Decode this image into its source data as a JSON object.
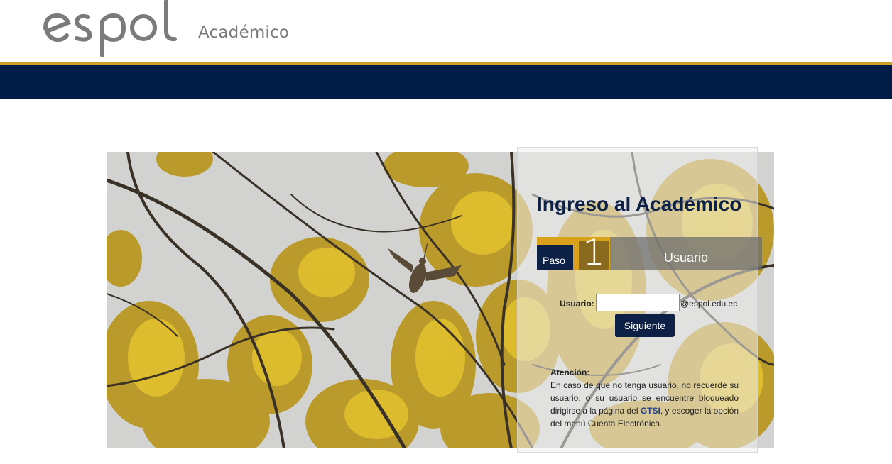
{
  "header": {
    "logo_text": "espol",
    "subtitle": "Académico"
  },
  "colors": {
    "navy": "#001c44",
    "gold": "#c9a227",
    "panel_title": "#0d2147"
  },
  "login": {
    "title": "Ingreso al Académico",
    "step_prefix": "Paso",
    "step_number": "1",
    "step_name": "Usuario",
    "user_label": "Usuario:",
    "user_value": "",
    "domain_suffix": "@espol.edu.ec",
    "submit_label": "Siguiente"
  },
  "notice": {
    "heading": "Atención:",
    "text_before_link": "En caso de que no tenga usuario, no recuerde su usuario, o su usuario se encuentre bloqueado dirigirse a la página del ",
    "link_text": "GTSI",
    "text_after_link": ", y escoger la opción del menú Cuenta Electrónica."
  }
}
